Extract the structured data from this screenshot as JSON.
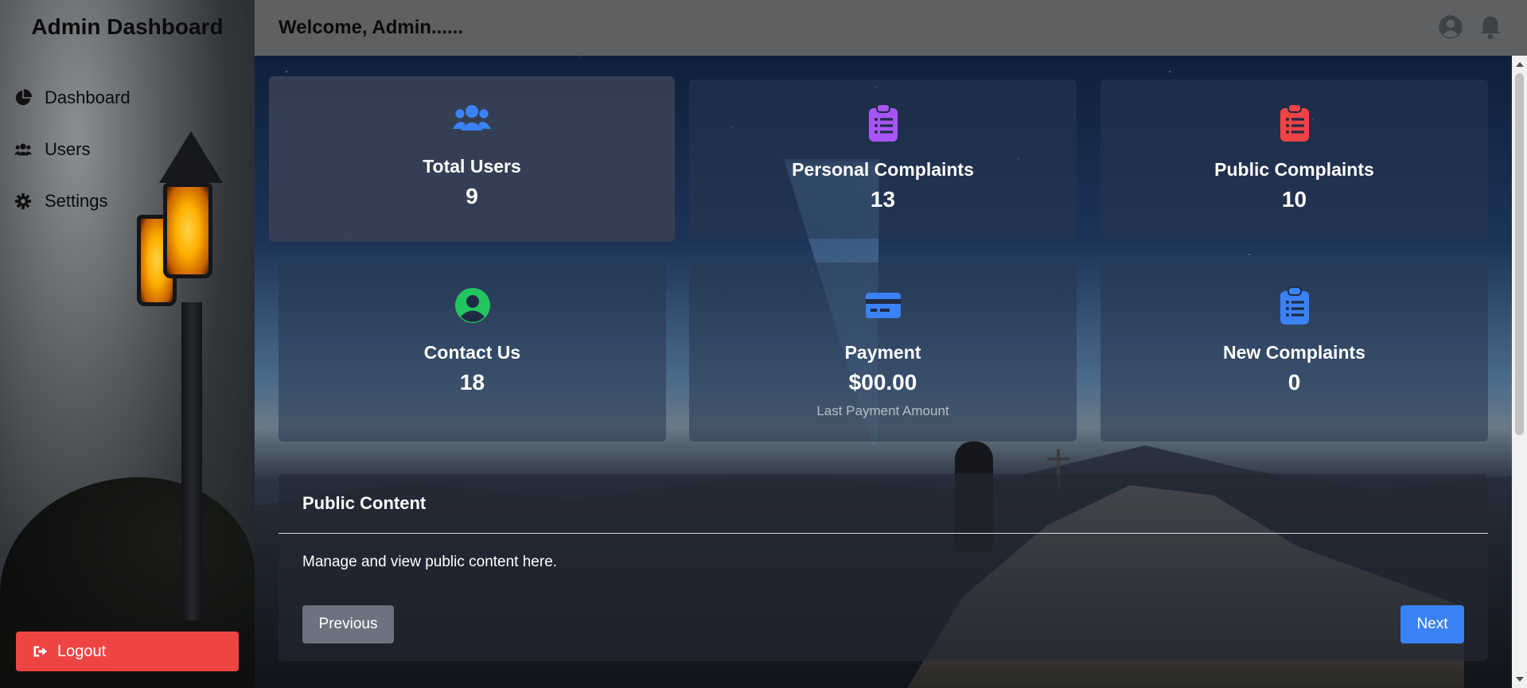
{
  "sidebar": {
    "title": "Admin Dashboard",
    "items": [
      {
        "label": "Dashboard",
        "icon": "chart-pie-icon"
      },
      {
        "label": "Users",
        "icon": "users-icon"
      },
      {
        "label": "Settings",
        "icon": "gear-icon"
      }
    ],
    "logout_label": "Logout"
  },
  "header": {
    "welcome": "Welcome, Admin......",
    "icons": [
      "user-circle-icon",
      "bell-icon"
    ]
  },
  "cards": [
    {
      "title": "Total Users",
      "value": "9",
      "icon": "users-icon",
      "color": "#3b82f6"
    },
    {
      "title": "Personal Complaints",
      "value": "13",
      "icon": "clipboard-list-icon",
      "color": "#a855f7"
    },
    {
      "title": "Public Complaints",
      "value": "10",
      "icon": "clipboard-list-icon",
      "color": "#ef4444"
    },
    {
      "title": "Contact Us",
      "value": "18",
      "icon": "user-circle-icon",
      "color": "#22c55e"
    },
    {
      "title": "Payment",
      "value": "$00.00",
      "sub": "Last Payment Amount",
      "icon": "credit-card-icon",
      "color": "#3b82f6"
    },
    {
      "title": "New Complaints",
      "value": "0",
      "icon": "clipboard-list-icon",
      "color": "#3b82f6"
    }
  ],
  "panel": {
    "title": "Public Content",
    "description": "Manage and view public content here.",
    "prev_label": "Previous",
    "next_label": "Next"
  },
  "colors": {
    "logout": "#ef4444",
    "next_button": "#3b82f6",
    "prev_button": "#6b7280",
    "header_bg": "#5e6062"
  }
}
